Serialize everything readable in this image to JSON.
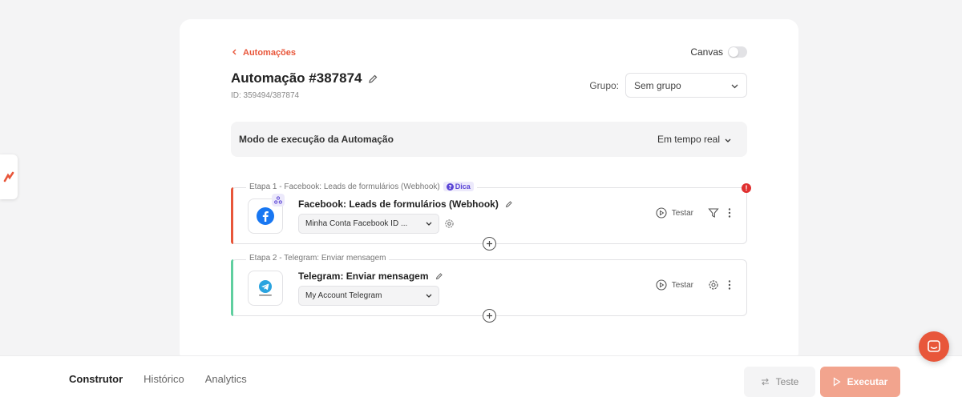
{
  "header": {
    "back_label": "Automações",
    "canvas_label": "Canvas",
    "title": "Automação #387874",
    "id_text": "ID: 359494/387874",
    "group_label": "Grupo:",
    "group_value": "Sem grupo"
  },
  "mode": {
    "label": "Modo de execução da Automação",
    "value": "Em tempo real"
  },
  "steps": [
    {
      "caption": "Etapa 1 - Facebook: Leads de formulários (Webhook)",
      "tip_label": "Dica",
      "title": "Facebook: Leads de formulários (Webhook)",
      "account": "Minha Conta Facebook ID ...",
      "test_label": "Testar",
      "accent_color": "#e8563a",
      "has_error": true,
      "error_glyph": "!"
    },
    {
      "caption": "Etapa 2 - Telegram: Enviar mensagem",
      "title": "Telegram: Enviar mensagem",
      "account": "My Account Telegram",
      "test_label": "Testar",
      "accent_color": "#5fcf9f"
    }
  ],
  "footer": {
    "tabs": [
      {
        "label": "Construtor",
        "active": true
      },
      {
        "label": "Histórico",
        "active": false
      },
      {
        "label": "Analytics",
        "active": false
      }
    ],
    "test_button": "Teste",
    "run_button": "Executar"
  },
  "colors": {
    "brand": "#e8563a",
    "run_button_bg": "#f2a48e",
    "facebook": "#1877f2",
    "telegram": "#2aa3df",
    "tip": "#5b45d6"
  },
  "icons": [
    "chevron-left-icon",
    "toggle-switch",
    "pencil-icon",
    "chevron-down-icon",
    "facebook-icon",
    "webhook-icon",
    "telegram-icon",
    "gear-icon",
    "play-circle-icon",
    "filter-icon",
    "more-vertical-icon",
    "plus-circle-icon",
    "swap-icon",
    "play-icon",
    "chat-icon"
  ]
}
